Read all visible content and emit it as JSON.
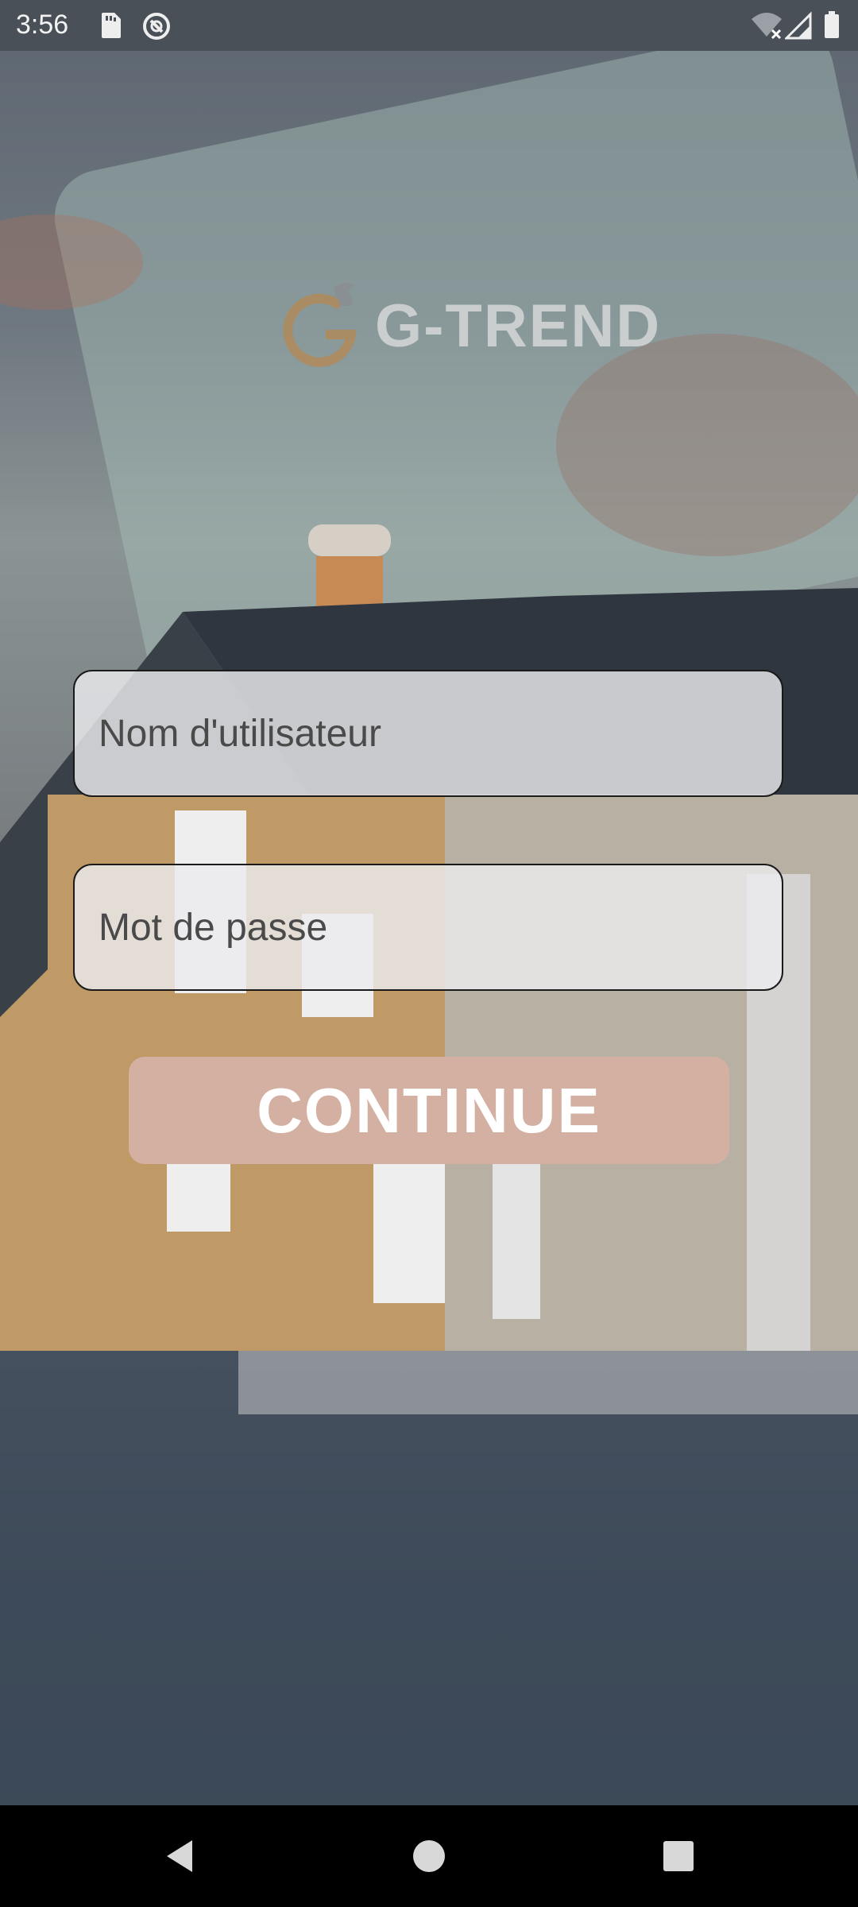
{
  "status_bar": {
    "time": "3:56",
    "icons": [
      "sd-card-icon",
      "do-not-disturb-icon",
      "wifi-off-icon",
      "cell-signal-icon",
      "battery-icon"
    ]
  },
  "logo": {
    "text": "G-TREND",
    "accent_color": "#b08a5a"
  },
  "form": {
    "username": {
      "placeholder": "Nom d'utilisateur",
      "value": ""
    },
    "password": {
      "placeholder": "Mot de passe",
      "value": ""
    },
    "continue_label": "CONTINUE",
    "button_color": "#d3b0a2"
  },
  "nav_bar": {
    "buttons": [
      "back-icon",
      "home-icon",
      "recents-icon"
    ]
  }
}
